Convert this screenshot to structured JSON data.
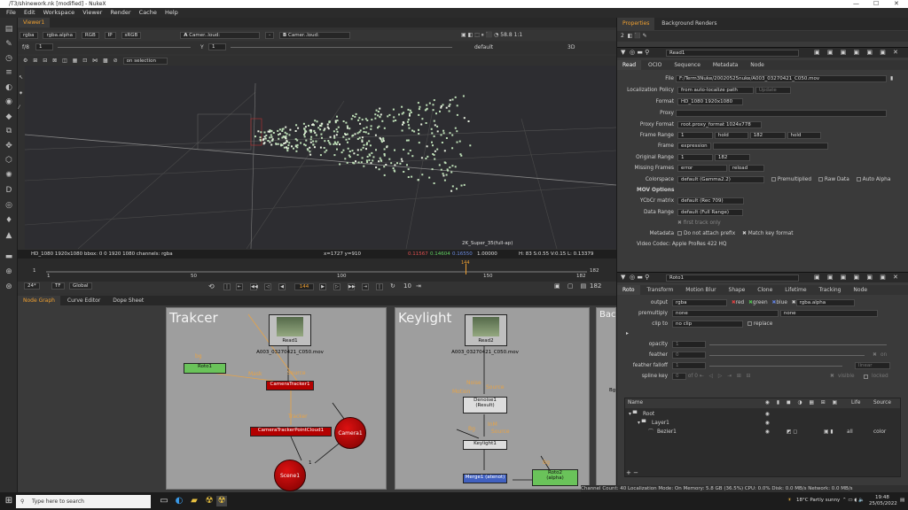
{
  "window": {
    "title": "/T3/shinework.nk [modified] - NukeX"
  },
  "menu": [
    "File",
    "Edit",
    "Workspace",
    "Viewer",
    "Render",
    "Cache",
    "Help"
  ],
  "viewer": {
    "tab": "Viewer1",
    "channels": "rgba",
    "alpha": "rgba.alpha",
    "colorspace_label": "RGB",
    "ip": "IP",
    "lut": "sRGB",
    "a_input": "Camer..loud:",
    "b_input": "Camer..loud:",
    "gain_label": "f/8",
    "gain_value": "1",
    "gamma_label": "Y",
    "gamma_value": "1",
    "zoom": "58.8",
    "ratio": "1:1",
    "view_mode": "3D",
    "default_label": "default",
    "on_selection": "on selection",
    "format_overlay": "2K_Super_35(full-ap)",
    "info_format": "HD_1080 1920x1080  bbox: 0 0 1920 1080 channels: rgba",
    "info_coords": "x=1727 y=910",
    "info_r": "0.11567",
    "info_g": "0.14604",
    "info_b": "0.16550",
    "info_a": "1.00000",
    "info_hsv": "H: 83 S:0.55 V:0.15  L: 0.13379"
  },
  "timeline": {
    "start": "1",
    "end": "182",
    "ticks": [
      "1",
      "50",
      "100",
      "150",
      "182"
    ],
    "fps": "24*",
    "tf": "TF",
    "scope": "Global",
    "current_frame": "144",
    "step": "10",
    "marker_label": "144"
  },
  "nodegraph": {
    "tabs": [
      "Node Graph",
      "Curve Editor",
      "Dope Sheet"
    ],
    "backdrops": [
      "Trakcer",
      "Keylight",
      "Bac"
    ],
    "read1_label": "Read1",
    "read1_file": "A003_03270421_C050.mov",
    "read2_label": "Read2",
    "read2_file": "A003_03270421_C050.mov",
    "roto1": "Roto1",
    "bg": "bg",
    "mask": "Mask",
    "source": "Source",
    "cameratracker": "CameraTracker1",
    "tracker": "Tracker",
    "pointcloud": "CameraTrackerPointCloud1",
    "camera": "Camera1",
    "scene": "Scene1",
    "scene_port": "1",
    "noise": "Noise",
    "motion": "Motion",
    "source2": "Source",
    "denoise": "Denoise1",
    "denoise_sub": "(Result)",
    "keylight": "Keylight1",
    "bg2": "Bg",
    "inm": "InM",
    "source3": "Source",
    "merge": "Merge1 (atenot)",
    "roto2": "Roto2",
    "roto2_sub": "(alpha)",
    "bg3": "Bg",
    "bg4": "Bg"
  },
  "properties": {
    "tabs": [
      "Properties",
      "Background Renders"
    ],
    "node_count": "2",
    "read_node": "Read1",
    "read_tabs": [
      "Read",
      "OCIO",
      "Sequence",
      "Metadata",
      "Node"
    ],
    "file_label": "File",
    "file_value": "F:/Term3Nuke/20020525nuke/A003_03270421_C050.mov",
    "localization_label": "Localization Policy",
    "localization_value": "from auto-localize path",
    "update_btn": "Update",
    "format_label": "Format",
    "format_value": "HD_1080 1920x1080",
    "proxy_label": "Proxy",
    "proxy_format_label": "Proxy Format",
    "proxy_format_value": "root.proxy_format 1024x778",
    "frame_range_label": "Frame Range",
    "frame_range_start": "1",
    "frame_range_before": "hold",
    "frame_range_end": "182",
    "frame_range_after": "hold",
    "frame_label": "Frame",
    "frame_value": "expression",
    "original_range_label": "Original Range",
    "original_range_start": "1",
    "original_range_end": "182",
    "missing_label": "Missing Frames",
    "missing_value": "error",
    "reload_btn": "reload",
    "colorspace_label": "Colorspace",
    "colorspace_value": "default (Gamma2.2)",
    "premultiplied": "Premultiplied",
    "raw_data": "Raw Data",
    "auto_alpha": "Auto Alpha",
    "mov_options": "MOV Options",
    "ycbcr_label": "YCbCr matrix",
    "ycbcr_value": "default (Rec 709)",
    "data_range_label": "Data Range",
    "data_range_value": "default (Full Range)",
    "first_track": "first track only",
    "metadata_label": "Metadata",
    "no_prefix": "Do not attach prefix",
    "match_key": "Match key format",
    "video_codec": "Video Codec:  Apple ProRes 422 HQ",
    "roto_node": "Roto1",
    "roto_tabs": [
      "Roto",
      "Transform",
      "Motion Blur",
      "Shape",
      "Clone",
      "Lifetime",
      "Tracking",
      "Node"
    ],
    "output_label": "output",
    "output_value": "rgba",
    "ch_red": "red",
    "ch_green": "green",
    "ch_blue": "blue",
    "ch_alpha": "rgba.alpha",
    "premultiply_label": "premultiply",
    "premultiply_value": "none",
    "premultiply_value2": "none",
    "clip_label": "clip to",
    "clip_value": "no clip",
    "replace": "replace",
    "opacity_label": "opacity",
    "opacity_value": "1",
    "feather_label": "feather",
    "feather_value": "0",
    "falloff_label": "feather falloff",
    "falloff_value": "1",
    "falloff_type": "linear",
    "on_label": "on",
    "spline_key_label": "spline key",
    "spline_key_value": "0",
    "spline_key_of": "of",
    "spline_key_total": "0",
    "visible": "visible",
    "locked": "locked",
    "tree_headers": [
      "Name",
      "Life",
      "Source"
    ],
    "tree_root": "Root",
    "tree_layer": "Layer1",
    "tree_bezier": "Bezier1",
    "bezier_life": "all",
    "bezier_source": "color",
    "ticks_roto": [
      "1",
      "2",
      "3",
      "4",
      "5",
      "6"
    ]
  },
  "status": "Channel Count: 40  Localization Mode: On  Memory: 5.8 GB (36.5%)  CPU: 0.0%  Disk: 0.0 MB/s  Network: 0.0 MB/s",
  "taskbar": {
    "search": "Type here to search",
    "weather": "18°C  Partly sunny",
    "time": "19:48",
    "date": "25/05/2022"
  }
}
